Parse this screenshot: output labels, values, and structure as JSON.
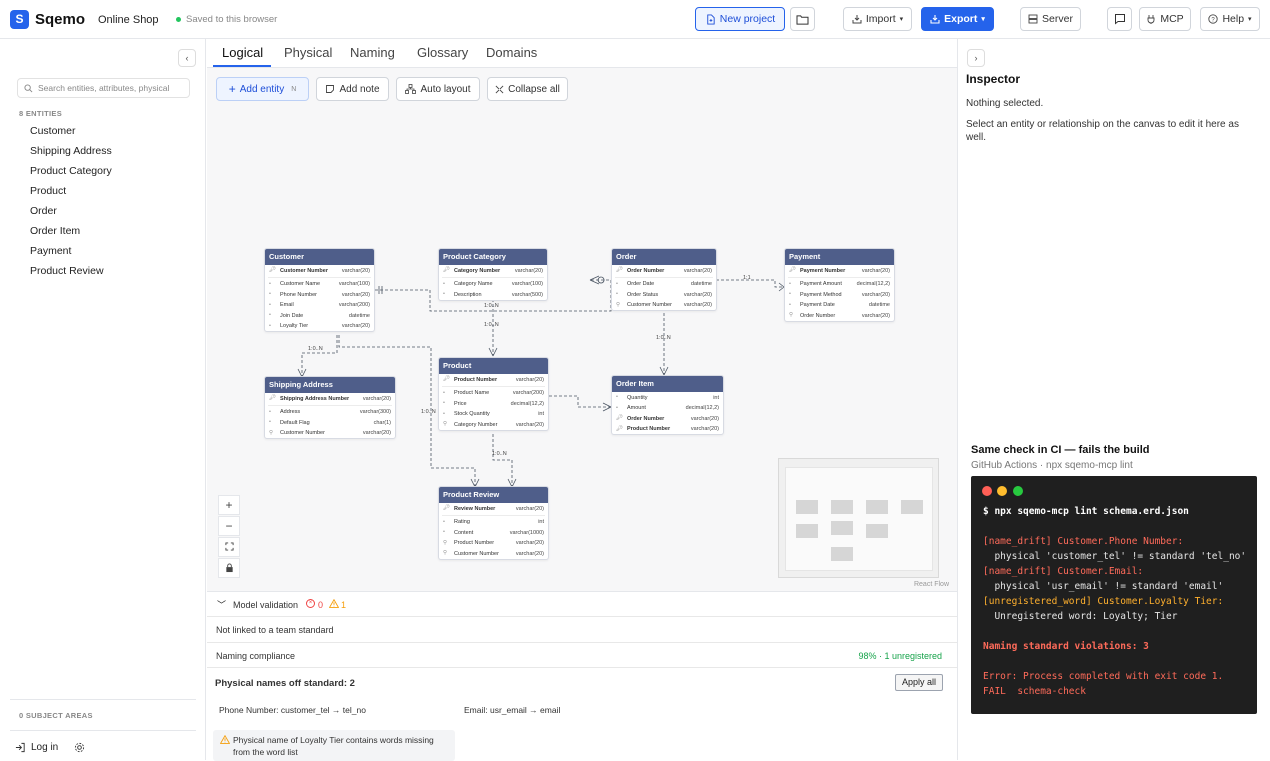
{
  "app": {
    "logo_letter": "S",
    "name": "Sqemo",
    "project": "Online Shop",
    "saved_status": "Saved to this browser"
  },
  "toolbar": {
    "new_project": "New project",
    "import": "Import",
    "export": "Export",
    "server": "Server",
    "mcp": "MCP",
    "help": "Help"
  },
  "sidebar": {
    "search_placeholder": "Search entities, attributes, physical",
    "entities_count_label": "8 ENTITIES",
    "entities": [
      "Customer",
      "Shipping Address",
      "Product Category",
      "Product",
      "Order",
      "Order Item",
      "Payment",
      "Product Review"
    ],
    "subject_areas_label": "0 SUBJECT AREAS",
    "login": "Log in"
  },
  "tabs": [
    "Logical",
    "Physical",
    "Naming",
    "Glossary",
    "Domains"
  ],
  "canvas_toolbar": {
    "add_entity": "Add entity",
    "add_entity_shortcut": "N",
    "add_note": "Add note",
    "auto_layout": "Auto layout",
    "collapse_all": "Collapse all"
  },
  "canvas": {
    "attribution": "React Flow",
    "zoom_in": "+",
    "zoom_out": "−"
  },
  "diagram": {
    "customer": {
      "title": "Customer",
      "rows": [
        [
          "Customer Number",
          "varchar(20)"
        ],
        [
          "Customer Name",
          "varchar(100)"
        ],
        [
          "Phone Number",
          "varchar(20)"
        ],
        [
          "Email",
          "varchar(200)"
        ],
        [
          "Join Date",
          "datetime"
        ],
        [
          "Loyalty Tier",
          "varchar(20)"
        ]
      ]
    },
    "category": {
      "title": "Product Category",
      "rows": [
        [
          "Category Number",
          "varchar(20)"
        ],
        [
          "Category Name",
          "varchar(100)"
        ],
        [
          "Description",
          "varchar(500)"
        ]
      ]
    },
    "order": {
      "title": "Order",
      "rows": [
        [
          "Order Number",
          "varchar(20)"
        ],
        [
          "Order Date",
          "datetime"
        ],
        [
          "Order Status",
          "varchar(20)"
        ],
        [
          "Customer Number",
          "varchar(20)"
        ]
      ]
    },
    "payment": {
      "title": "Payment",
      "rows": [
        [
          "Payment Number",
          "varchar(20)"
        ],
        [
          "Payment Amount",
          "decimal(12,2)"
        ],
        [
          "Payment Method",
          "varchar(20)"
        ],
        [
          "Payment Date",
          "datetime"
        ],
        [
          "Order Number",
          "varchar(20)"
        ]
      ]
    },
    "shipping": {
      "title": "Shipping Address",
      "rows": [
        [
          "Shipping Address Number",
          "varchar(20)"
        ],
        [
          "Address",
          "varchar(300)"
        ],
        [
          "Default Flag",
          "char(1)"
        ],
        [
          "Customer Number",
          "varchar(20)"
        ]
      ]
    },
    "product": {
      "title": "Product",
      "rows": [
        [
          "Product Number",
          "varchar(20)"
        ],
        [
          "Product Name",
          "varchar(200)"
        ],
        [
          "Price",
          "decimal(12,2)"
        ],
        [
          "Stock Quantity",
          "int"
        ],
        [
          "Category Number",
          "varchar(20)"
        ]
      ]
    },
    "orderitem": {
      "title": "Order Item",
      "rows": [
        [
          "Quantity",
          "int"
        ],
        [
          "Amount",
          "decimal(12,2)"
        ],
        [
          "Order Number",
          "varchar(20)"
        ],
        [
          "Product Number",
          "varchar(20)"
        ]
      ]
    },
    "review": {
      "title": "Product Review",
      "rows": [
        [
          "Review Number",
          "varchar(20)"
        ],
        [
          "Rating",
          "int"
        ],
        [
          "Content",
          "varchar(1000)"
        ],
        [
          "Product Number",
          "varchar(20)"
        ],
        [
          "Customer Number",
          "varchar(20)"
        ]
      ]
    },
    "cardinality": {
      "one_to_many": "1:0..N",
      "one_to_one": "1:1"
    }
  },
  "validation": {
    "title": "Model validation",
    "error_count": "0",
    "warning_count": "1",
    "team_standard": "Not linked to a team standard",
    "naming_compliance_label": "Naming compliance",
    "naming_compliance_value": "98% · 1 unregistered",
    "off_standard_title": "Physical names off standard: 2",
    "apply_all": "Apply all",
    "suggestions": [
      "Phone Number: customer_tel → tel_no",
      "Email: usr_email → email"
    ],
    "warning": "Physical name of Loyalty Tier contains words missing from the word list"
  },
  "inspector": {
    "title": "Inspector",
    "empty": "Nothing selected.",
    "hint": "Select an entity or relationship on the canvas to edit it here as well."
  },
  "ci": {
    "title": "Same check in CI — fails the build",
    "subtitle": "GitHub Actions · npx sqemo-mcp lint",
    "lines": [
      "$ npx sqemo-mcp lint schema.erd.json",
      "[name_drift] Customer.Phone Number:",
      "  physical 'customer_tel' != standard 'tel_no'",
      "[name_drift] Customer.Email:",
      "  physical 'usr_email' != standard 'email'",
      "[unregistered_word] Customer.Loyalty Tier:",
      "  Unregistered word: Loyalty; Tier",
      "Naming standard violations: 3",
      "Error: Process completed with exit code 1.",
      "FAIL  schema-check"
    ]
  },
  "colors": {
    "accent": "#2563eb",
    "entity_header": "#4f5e8a",
    "error": "#ef4444",
    "warning": "#f59e0b",
    "success": "#16a34a",
    "terminal_red": "#ff6b5a"
  }
}
